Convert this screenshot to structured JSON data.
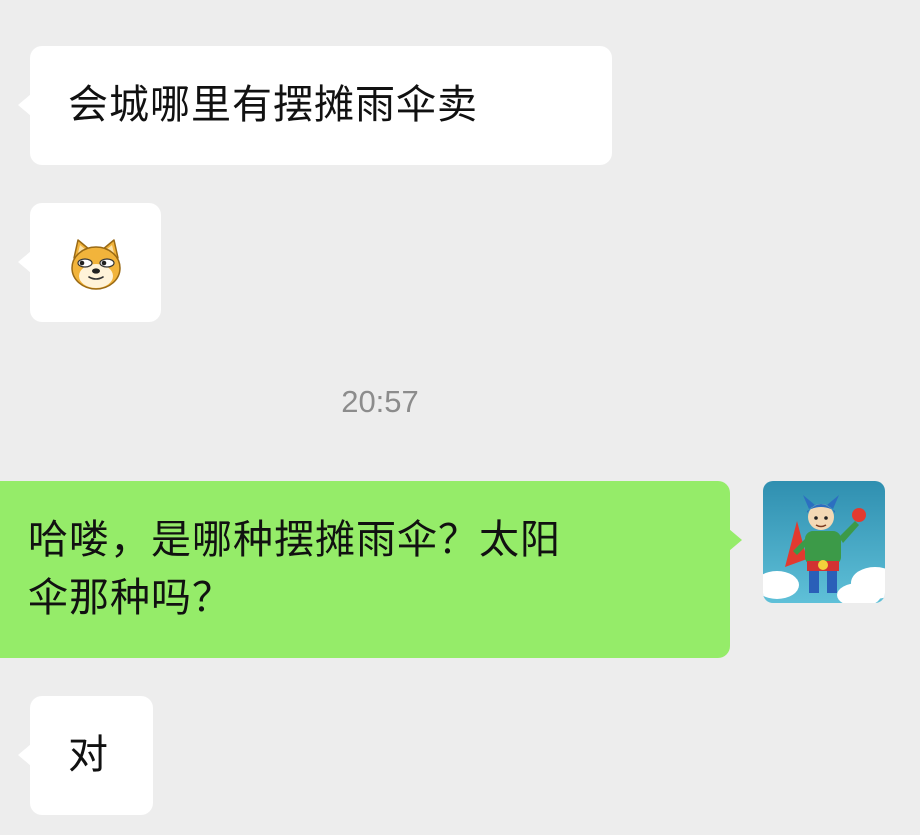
{
  "chat": {
    "messages": [
      {
        "side": "incoming",
        "type": "text",
        "text": "会城哪里有摆摊雨伞卖"
      },
      {
        "side": "incoming",
        "type": "emoji",
        "emoji": "doge-face-icon"
      },
      {
        "side": "outgoing",
        "type": "text",
        "text": "哈喽，是哪种摆摊雨伞？太阳\n伞那种吗？"
      },
      {
        "side": "incoming",
        "type": "text",
        "text": "对"
      }
    ],
    "timestamp": "20:57"
  },
  "colors": {
    "background": "#ededed",
    "incoming_bubble": "#ffffff",
    "outgoing_bubble": "#95ec69",
    "timestamp_text": "#8c8c8c"
  },
  "avatar": {
    "icon": "superhero-avatar-icon"
  }
}
